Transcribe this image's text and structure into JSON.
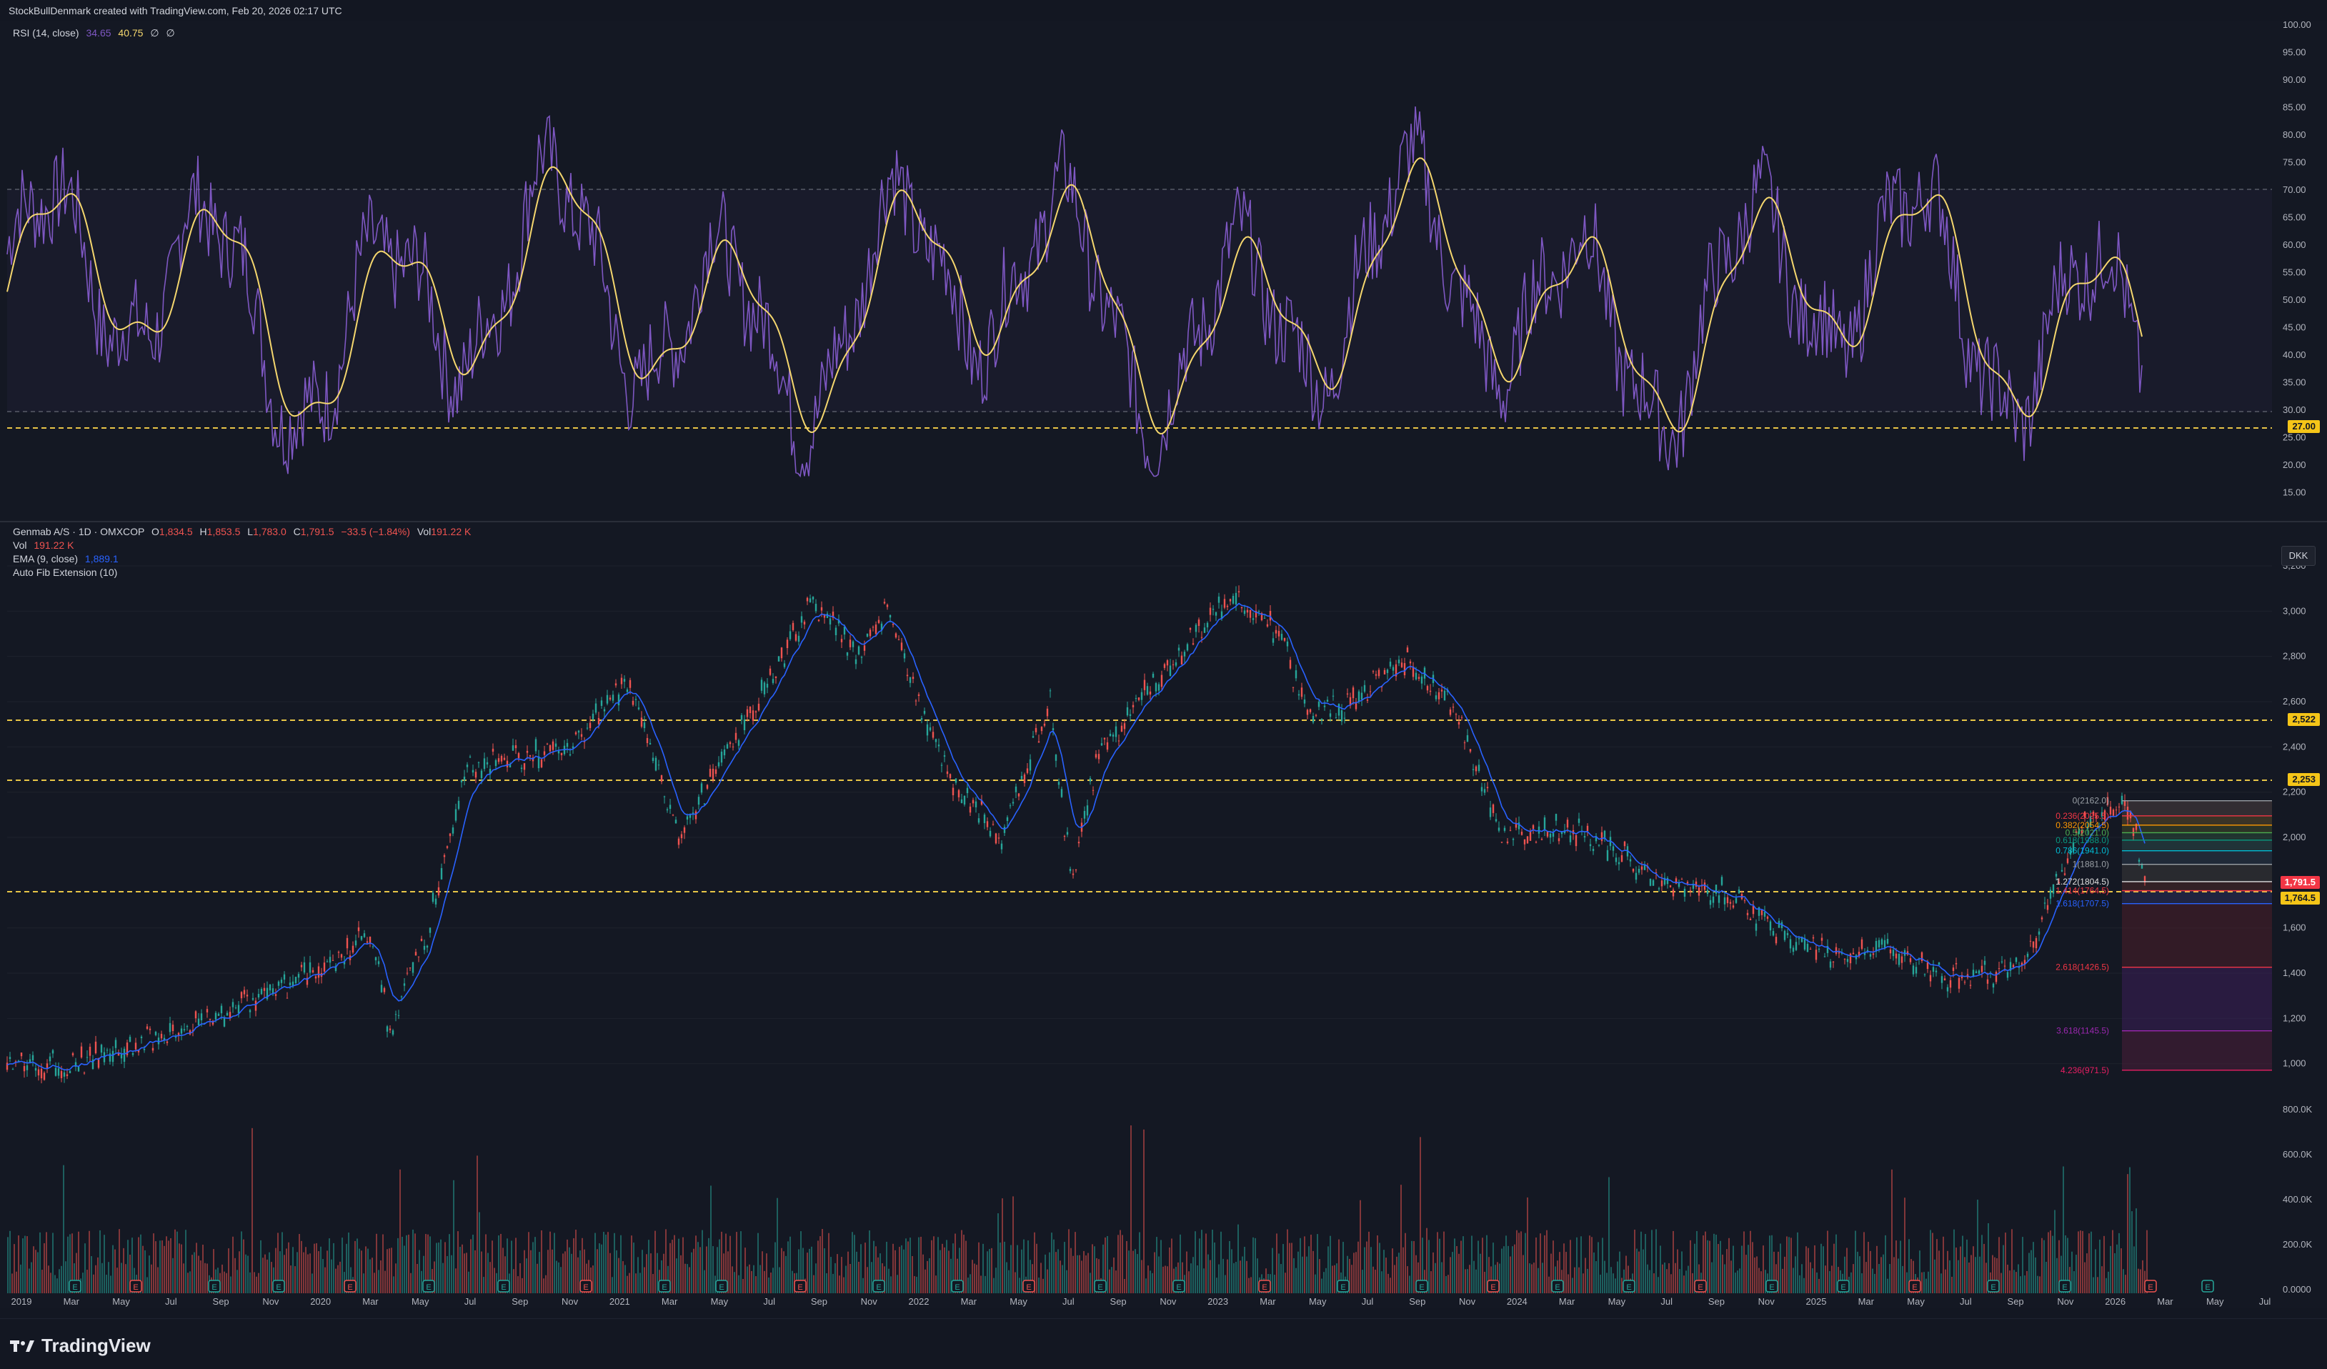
{
  "header": {
    "title": "StockBullDenmark created with TradingView.com, Feb 20, 2026 02:17 UTC"
  },
  "rsi_legend": {
    "name": "RSI (14, close)",
    "rsi_value": "34.65",
    "ma_value": "40.75",
    "extra1": "∅",
    "extra2": "∅"
  },
  "main_legend": {
    "symbol": "Genmab A/S · 1D · OMXCOP",
    "o_label": "O",
    "o": "1,834.5",
    "h_label": "H",
    "h": "1,853.5",
    "l_label": "L",
    "l": "1,783.0",
    "c_label": "C",
    "c": "1,791.5",
    "change": "−33.5 (−1.84%)",
    "vol_label": "Vol",
    "vol": "191.22 K",
    "vol_line_label": "Vol",
    "vol_line_value": "191.22 K",
    "ema_label": "EMA (9, close)",
    "ema_value": "1,889.1",
    "fib_label": "Auto Fib Extension (10)"
  },
  "currency": "DKK",
  "rsi_axis": [
    "100.00",
    "95.00",
    "90.00",
    "85.00",
    "80.00",
    "75.00",
    "70.00",
    "65.00",
    "60.00",
    "55.00",
    "50.00",
    "45.00",
    "40.00",
    "35.00",
    "30.00",
    "25.00",
    "20.00",
    "15.00"
  ],
  "price_axis": [
    "3,200",
    "3,000",
    "2,800",
    "2,600",
    "2,400",
    "2,200",
    "2,000",
    "1,600",
    "1,400",
    "1,200",
    "1,000"
  ],
  "volume_axis": [
    "800.0K",
    "600.0K",
    "400.0K",
    "200.0K",
    "0.0000"
  ],
  "time_axis": [
    "2019",
    "Mar",
    "May",
    "Jul",
    "Sep",
    "Nov",
    "2020",
    "Mar",
    "May",
    "Jul",
    "Sep",
    "Nov",
    "2021",
    "Mar",
    "May",
    "Jul",
    "Sep",
    "Nov",
    "2022",
    "Mar",
    "May",
    "Jul",
    "Sep",
    "Nov",
    "2023",
    "Mar",
    "May",
    "Jul",
    "Sep",
    "Nov",
    "2024",
    "Mar",
    "May",
    "Jul",
    "Sep",
    "Nov",
    "2025",
    "Mar",
    "May",
    "Jul",
    "Sep",
    "Nov",
    "2026",
    "Mar",
    "May",
    "Jul"
  ],
  "price_tags": {
    "rsi_level": "27.00",
    "level_2522": "2,522",
    "level_2253": "2,253",
    "last_price": "1,791.5",
    "level_1764": "1,764.5"
  },
  "fib_levels": [
    {
      "label": "0(2162.0)",
      "color": "#9aa0a6"
    },
    {
      "label": "0.236(2095.5)",
      "color": "#f23645"
    },
    {
      "label": "0.382(2054.5)",
      "color": "#ff9800"
    },
    {
      "label": "0.5(2021.0)",
      "color": "#4caf50"
    },
    {
      "label": "0.618(1988.0)",
      "color": "#089981"
    },
    {
      "label": "0.786(1941.0)",
      "color": "#00bcd4"
    },
    {
      "label": "1(1881.0)",
      "color": "#9aa0a6"
    },
    {
      "label": "1.272(1804.5)",
      "color": "#e0e0e0"
    },
    {
      "label": "1.414(1764.5)",
      "color": "#f23645"
    },
    {
      "label": "1.618(1707.5)",
      "color": "#2962ff"
    },
    {
      "label": "2.618(1426.5)",
      "color": "#f23645"
    },
    {
      "label": "3.618(1145.5)",
      "color": "#9c27b0"
    },
    {
      "label": "4.236(971.5)",
      "color": "#e91e63"
    }
  ],
  "event_markers": {
    "earnings_glyph": "E",
    "dividend_glyph": "E"
  },
  "footer": {
    "brand": "TradingView"
  },
  "colors": {
    "background": "#131722",
    "rsi_line": "#7e57c2",
    "rsi_ma": "#f5d76e",
    "candle_up": "#26a69a",
    "candle_down": "#ef5350",
    "ema": "#2962ff",
    "dash_level": "#e8c547"
  }
}
